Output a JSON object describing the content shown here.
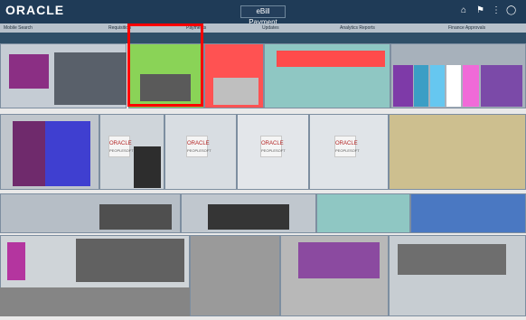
{
  "header": {
    "logo": "ORACLE",
    "title": "eBill Payment",
    "icons": [
      "home-icon",
      "flag-icon",
      "more-icon",
      "user-icon"
    ]
  },
  "subbar": {
    "tabs": [
      "Mobile Search",
      "Requisition",
      "Payments",
      "Updates",
      "Analytics Reports",
      "Finance Approvals"
    ]
  },
  "tiles": {
    "badge_logo": "ORACLE",
    "badge_sub": "PEOPLESOFT"
  },
  "colors": {
    "header": "#1f3b57",
    "highlight": "#ff0000",
    "accent_teal": "#8fc7c3",
    "accent_purple": "#7e3aa8",
    "accent_blue": "#4a78c2"
  }
}
